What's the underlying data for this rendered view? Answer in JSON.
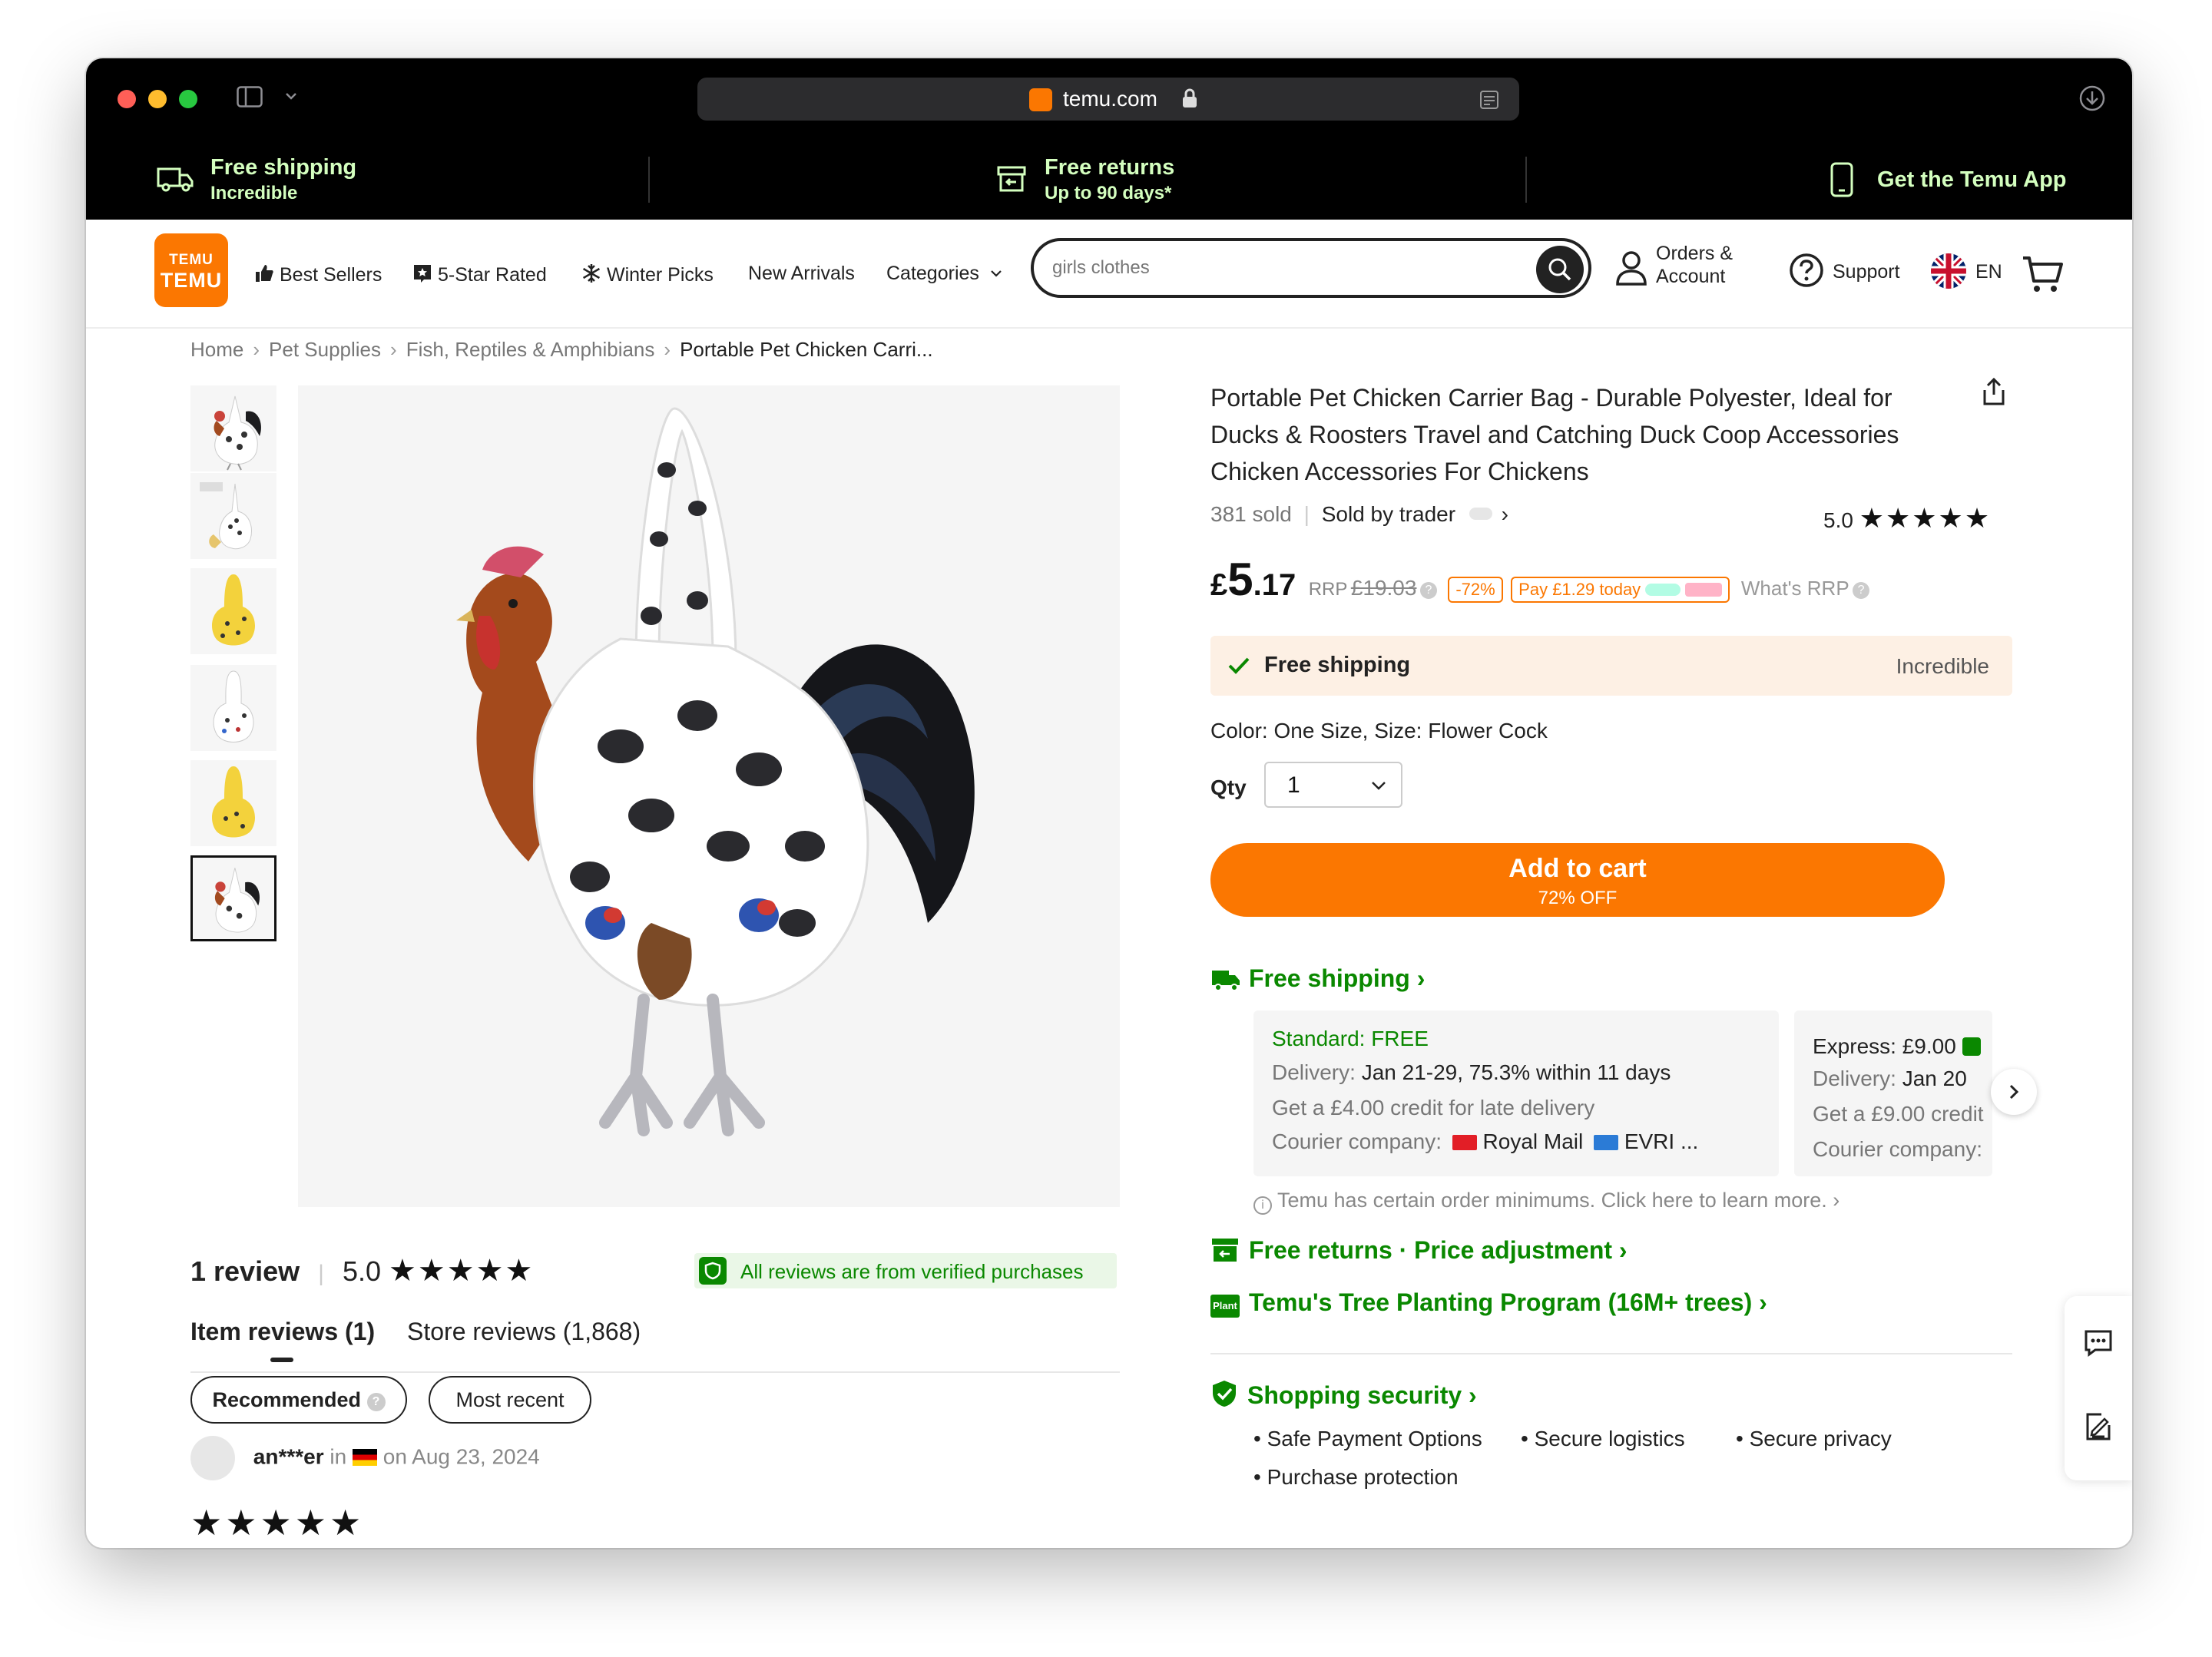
{
  "browser": {
    "url": "temu.com"
  },
  "promo": {
    "shipping_title": "Free shipping",
    "shipping_sub": "Incredible",
    "returns_title": "Free returns",
    "returns_sub": "Up to 90 days*",
    "app": "Get the Temu App"
  },
  "nav": {
    "logo_top": "TEMU",
    "logo_bottom": "TEMU",
    "links": [
      "Best Sellers",
      "5-Star Rated",
      "Winter Picks",
      "New Arrivals",
      "Categories"
    ],
    "search_value": "girls clothes",
    "orders_line1": "Orders &",
    "orders_line2": "Account",
    "support": "Support",
    "language": "EN"
  },
  "breadcrumb": [
    "Home",
    "Pet Supplies",
    "Fish, Reptiles & Amphibians",
    "Portable Pet Chicken Carri..."
  ],
  "product": {
    "title": "Portable Pet Chicken Carrier Bag - Durable Polyester, Ideal for Ducks & Roosters Travel and Catching Duck Coop Accessories Chicken Accessories For Chickens",
    "sold": "381 sold",
    "sold_by": "Sold by trader",
    "rating": "5.0",
    "price_currency": "£",
    "price_int": "5",
    "price_dec": ".17",
    "rrp_label": "RRP",
    "rrp_value": "£19.03",
    "discount": "-72%",
    "pay_today": "Pay £1.29 today",
    "whats_rrp": "What's RRP",
    "free_shipping": "Free shipping",
    "incredible": "Incredible",
    "color_size": "Color: One Size, Size: Flower Cock",
    "qty_label": "Qty",
    "qty_value": "1",
    "cart_label": "Add to cart",
    "cart_sub": "72% OFF"
  },
  "shipping": {
    "heading": "Free shipping",
    "standard_title": "Standard: FREE",
    "standard_delivery_label": "Delivery:",
    "standard_delivery": "Jan 21-29, 75.3% within 11 days",
    "standard_credit": "Get a £4.00 credit for late delivery",
    "courier_label": "Courier company:",
    "courier_1": "Royal Mail",
    "courier_2": "EVRI ...",
    "express_title": "Express: £9.00",
    "express_delivery_label": "Delivery:",
    "express_delivery": "Jan 20",
    "express_credit": "Get a £9.00 credit",
    "express_courier": "Courier company:",
    "minimums": "Temu has certain order minimums. Click here to learn more.",
    "returns": "Free returns · Price adjustment",
    "tree": "Temu's Tree Planting Program (16M+ trees)",
    "security": "Shopping security",
    "security_items": [
      "Safe Payment Options",
      "Secure logistics",
      "Secure privacy",
      "Purchase protection"
    ]
  },
  "reviews": {
    "count": "1 review",
    "rating": "5.0",
    "verified": "All reviews are from verified purchases",
    "tab_item": "Item reviews (1)",
    "tab_store": "Store reviews (1,868)",
    "filter_recommended": "Recommended",
    "filter_recent": "Most recent",
    "reviewer_name": "an***er",
    "reviewer_in": "in",
    "reviewer_date": "on Aug 23, 2024"
  },
  "colors": {
    "brand_orange": "#fb7701",
    "green": "#0a8800",
    "promo_text": "#d4ffbf"
  }
}
